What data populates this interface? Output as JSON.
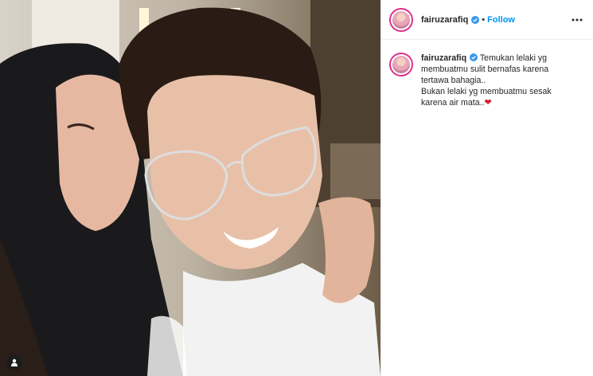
{
  "post": {
    "username": "fairuzarafiq",
    "separator": "•",
    "follow_label": "Follow",
    "caption": {
      "lines": [
        "Temukan lelaki yg",
        "membuatmu sulit bernafas karena",
        "tertawa bahagia..",
        "Bukan lelaki yg membuatmu sesak",
        "karena air mata.."
      ],
      "emoji": "❤"
    }
  },
  "icons": {
    "verified": "verified-badge-icon",
    "more": "more-options-icon",
    "tag": "user-tag-icon",
    "heart": "red-heart-emoji"
  },
  "colors": {
    "accent": "#0095f6",
    "ring": "#e0308a",
    "text": "#262626",
    "heart": "#d21f2c"
  }
}
